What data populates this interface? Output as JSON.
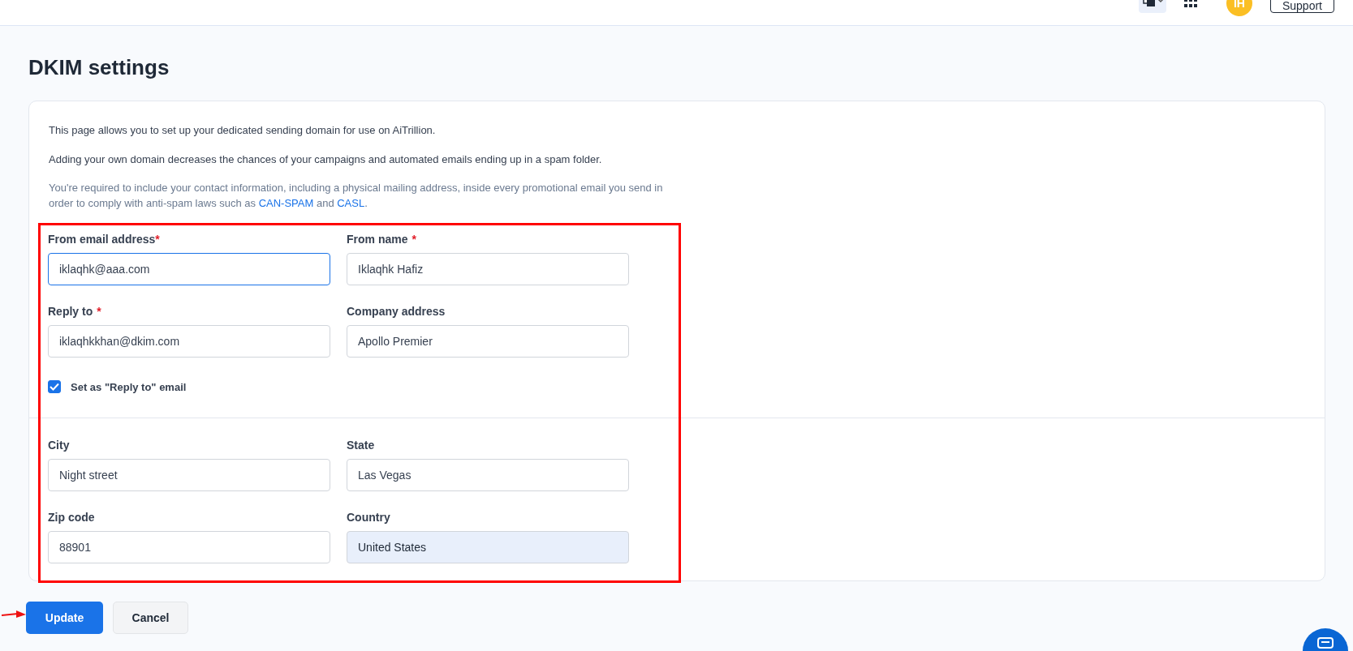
{
  "topbar": {
    "avatar_initials": "IH",
    "support_button": "Support"
  },
  "page_title": "DKIM settings",
  "intro": [
    "This page allows you to set up your dedicated sending domain for use on AiTrillion.",
    "Adding your own domain decreases the chances of your campaigns and automated emails ending up in a spam folder."
  ],
  "notice": {
    "text_before": "You're required to include your contact information, including a physical mailing address, inside every promotional email you send in order to comply with anti-spam laws such as",
    "links": [
      "CAN-SPAM",
      "CASL"
    ],
    "joiner": "and",
    "end": "."
  },
  "fields": [
    {
      "label": "From email address",
      "required_mark": "*",
      "value": "iklaqhk@aaa.com",
      "focused": true,
      "disabled": false
    },
    {
      "label": "From name",
      "required_mark": "*",
      "value": "Iklaqhk Hafiz",
      "focused": false,
      "disabled": false
    },
    {
      "label": "Reply to",
      "required_mark": "*",
      "value": "iklaqhkkhan@dkim.com",
      "focused": false,
      "disabled": false
    },
    {
      "label": "Company address",
      "value": "Apollo Premier",
      "focused": false,
      "disabled": false
    }
  ],
  "reply_checkbox": {
    "label": "Set as \"Reply to\" email",
    "checked": true
  },
  "address_fields": [
    {
      "label": "City",
      "value": "Night street",
      "focused": false,
      "disabled": false
    },
    {
      "label": "State",
      "value": "Las Vegas",
      "focused": false,
      "disabled": false
    },
    {
      "label": "Zip code",
      "value": "88901",
      "focused": false,
      "disabled": false
    },
    {
      "label": "Country",
      "value": "United States",
      "focused": false,
      "disabled": true
    }
  ],
  "buttons": [
    {
      "label": "Update",
      "kind": "primary"
    },
    {
      "label": "Cancel",
      "kind": "secondary"
    }
  ]
}
